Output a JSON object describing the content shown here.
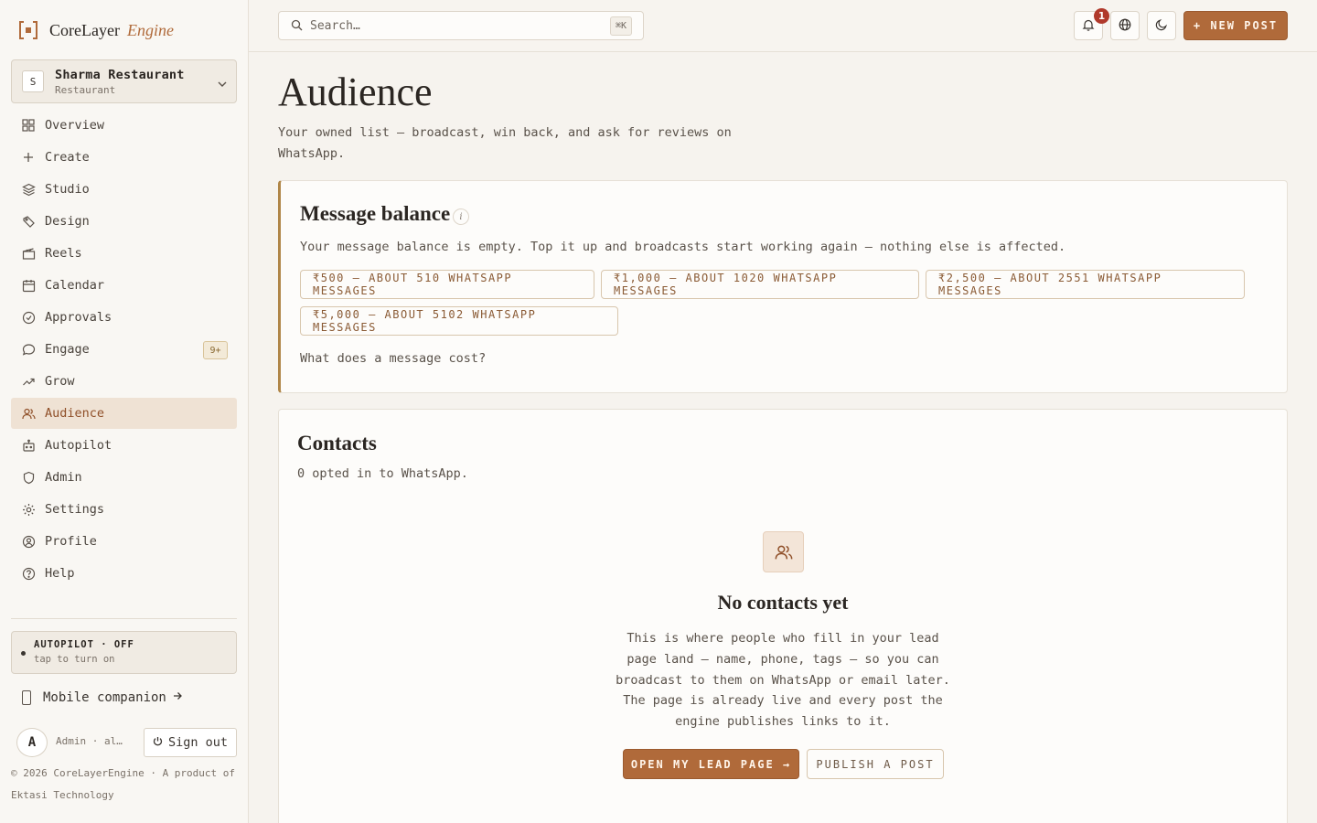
{
  "brand": {
    "name": "CoreLayer",
    "suffix": "Engine"
  },
  "workspace": {
    "initial": "S",
    "name": "Sharma Restaurant",
    "type": "Restaurant"
  },
  "nav": [
    {
      "label": "Overview",
      "icon": "grid-icon"
    },
    {
      "label": "Create",
      "icon": "plus-icon"
    },
    {
      "label": "Studio",
      "icon": "layers-icon"
    },
    {
      "label": "Design",
      "icon": "brush-icon"
    },
    {
      "label": "Reels",
      "icon": "clapper-icon"
    },
    {
      "label": "Calendar",
      "icon": "calendar-icon"
    },
    {
      "label": "Approvals",
      "icon": "check-circle-icon"
    },
    {
      "label": "Engage",
      "icon": "chat-icon",
      "badge": "9+"
    },
    {
      "label": "Grow",
      "icon": "trend-up-icon"
    },
    {
      "label": "Audience",
      "icon": "users-icon",
      "active": true
    },
    {
      "label": "Autopilot",
      "icon": "bot-icon"
    },
    {
      "label": "Admin",
      "icon": "shield-icon"
    },
    {
      "label": "Settings",
      "icon": "gear-icon"
    },
    {
      "label": "Profile",
      "icon": "user-circle-icon"
    },
    {
      "label": "Help",
      "icon": "help-circle-icon"
    }
  ],
  "autopilot": {
    "title": "AUTOPILOT · OFF",
    "subtitle": "tap to turn on"
  },
  "mobile": {
    "label": "Mobile companion"
  },
  "user": {
    "initial": "A",
    "meta": "Admin · al…",
    "signout": "Sign out"
  },
  "footer": {
    "copyright": "© 2026 CoreLayerEngine · A product of Ektasi Technology"
  },
  "topbar": {
    "search_placeholder": "Search…",
    "shortcut": "⌘K",
    "notification_count": "1",
    "new_post": "+ NEW POST"
  },
  "page": {
    "title": "Audience",
    "subtitle": "Your owned list — broadcast, win back, and ask for reviews on WhatsApp."
  },
  "balance": {
    "title": "Message balance",
    "info": "i",
    "description": "Your message balance is empty. Top it up and broadcasts start working again — nothing else is affected.",
    "options": [
      "₹500 — ABOUT 510 WHATSAPP MESSAGES",
      "₹1,000 — ABOUT 1020 WHATSAPP MESSAGES",
      "₹2,500 — ABOUT 2551 WHATSAPP MESSAGES",
      "₹5,000 — ABOUT 5102 WHATSAPP MESSAGES"
    ],
    "cost_link": "What does a message cost?"
  },
  "contacts": {
    "title": "Contacts",
    "count": "0 opted in to WhatsApp.",
    "empty_title": "No contacts yet",
    "empty_desc": "This is where people who fill in your lead page land — name, phone, tags — so you can broadcast to them on WhatsApp or email later. The page is already live and every post the engine publishes links to it.",
    "primary_action": "OPEN MY LEAD PAGE →",
    "secondary_action": "PUBLISH A POST"
  },
  "colors": {
    "accent": "#b06a3a",
    "active_bg": "#efe2d4",
    "badge": "#b0392b",
    "balance_border": "#b08648"
  }
}
